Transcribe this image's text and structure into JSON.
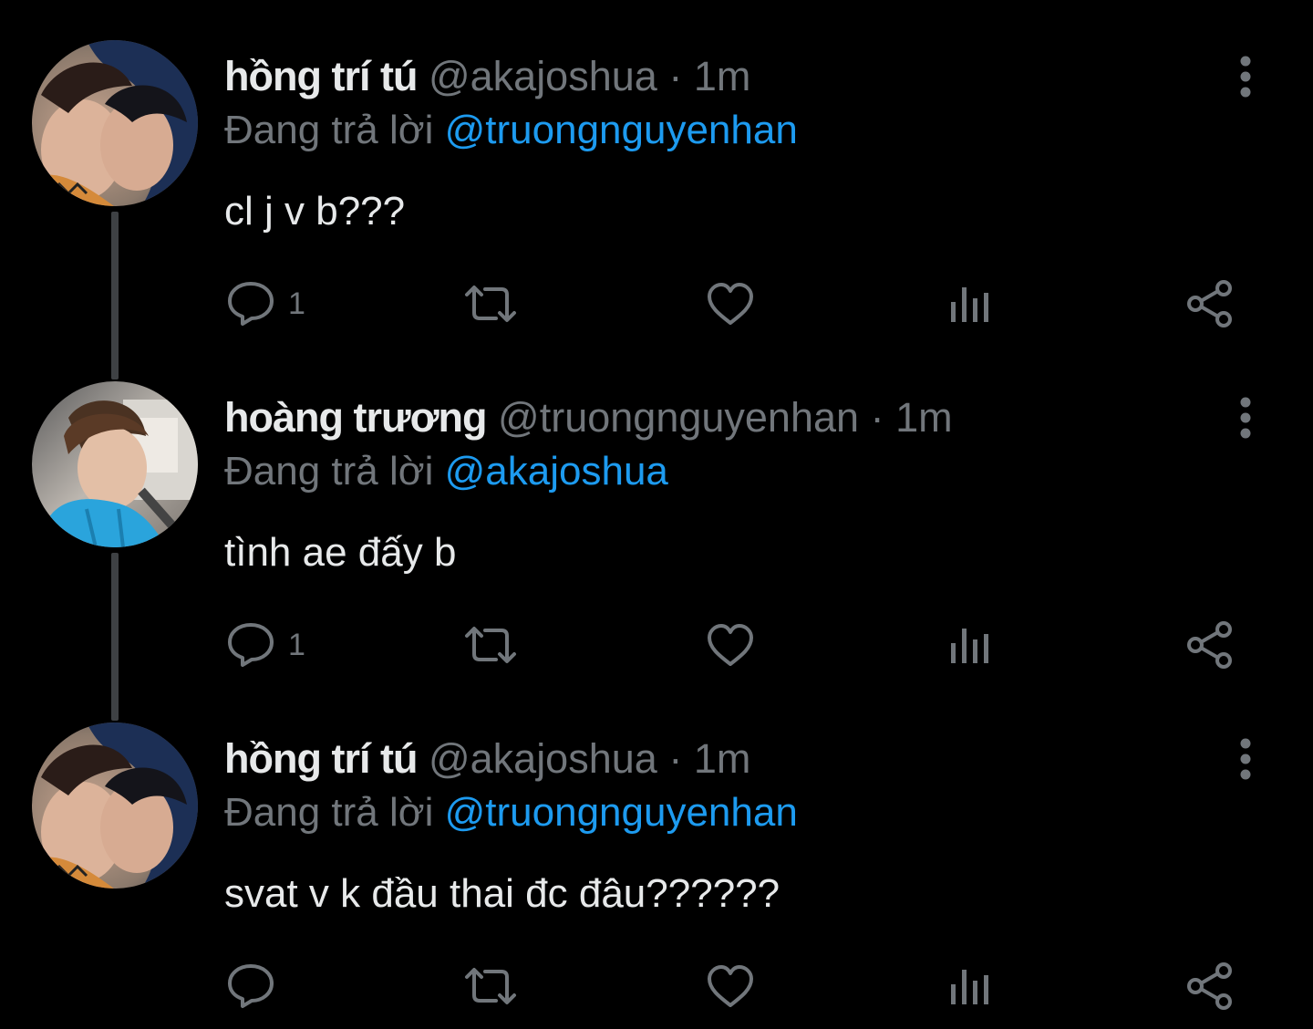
{
  "colors": {
    "background": "#000000",
    "text_primary": "#e7e9ea",
    "text_secondary": "#71767b",
    "accent": "#1d9bf0",
    "thread_line": "#3e4144"
  },
  "tweets": [
    {
      "display_name": "hồng trí tú",
      "handle": "@akajoshua",
      "separator": "·",
      "time": "1m",
      "reply_prefix": "Đang trả lời",
      "reply_to": "@truongnguyenhan",
      "text": "cl j v b???",
      "reply_count": "1",
      "icons": [
        "reply-icon",
        "retweet-icon",
        "like-icon",
        "analytics-icon",
        "share-icon",
        "more-icon"
      ]
    },
    {
      "display_name": "hoàng trương",
      "handle": "@truongnguyenhan",
      "separator": "·",
      "time": "1m",
      "reply_prefix": "Đang trả lời",
      "reply_to": "@akajoshua",
      "text": "tình ae đấy b",
      "reply_count": "1",
      "icons": [
        "reply-icon",
        "retweet-icon",
        "like-icon",
        "analytics-icon",
        "share-icon",
        "more-icon"
      ]
    },
    {
      "display_name": "hồng trí tú",
      "handle": "@akajoshua",
      "separator": "·",
      "time": "1m",
      "reply_prefix": "Đang trả lời",
      "reply_to": "@truongnguyenhan",
      "text": "svat v k đầu thai đc đâu??????",
      "reply_count": "",
      "icons": [
        "reply-icon",
        "retweet-icon",
        "like-icon",
        "analytics-icon",
        "share-icon",
        "more-icon"
      ]
    }
  ]
}
